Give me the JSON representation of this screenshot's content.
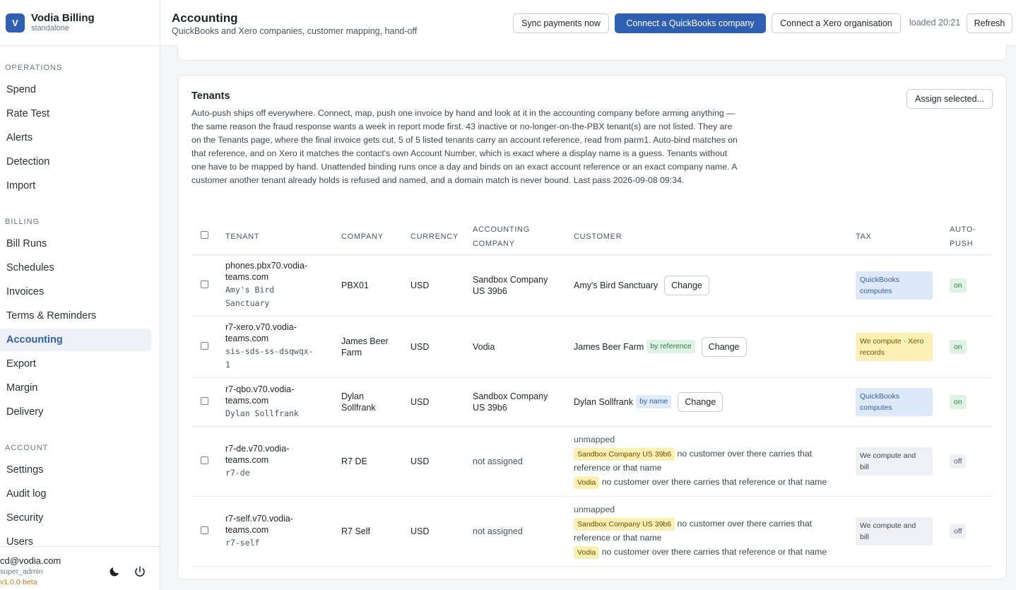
{
  "brand": {
    "logo_letter": "V",
    "name": "Vodia Billing",
    "sub": "standalone"
  },
  "nav": {
    "sections": [
      {
        "label": "OPERATIONS",
        "items": [
          "Spend",
          "Rate Test",
          "Alerts",
          "Detection",
          "Import"
        ]
      },
      {
        "label": "BILLING",
        "items": [
          "Bill Runs",
          "Schedules",
          "Invoices",
          "Terms & Reminders",
          "Accounting",
          "Export",
          "Margin",
          "Delivery"
        ]
      },
      {
        "label": "ACCOUNT",
        "items": [
          "Settings",
          "Audit log",
          "Security",
          "Users"
        ]
      }
    ],
    "active": "Accounting"
  },
  "user": {
    "email": "cd@vodia.com",
    "role": "super_admin",
    "version": "v1.0.0-beta"
  },
  "header": {
    "title": "Accounting",
    "subtitle": "QuickBooks and Xero companies, customer mapping, hand-off",
    "sync_label": "Sync payments now",
    "qb_label": "Connect a QuickBooks company",
    "xero_label": "Connect a Xero organisation",
    "loaded": "loaded 20:21",
    "refresh_label": "Refresh"
  },
  "tenants": {
    "title": "Tenants",
    "assign_label": "Assign selected...",
    "description": "Auto-push ships off everywhere. Connect, map, push one invoice by hand and look at it in the accounting company before arming anything — the same reason the fraud response wants a week in report mode first. 43 inactive or no-longer-on-the-PBX tenant(s) are not listed. They are on the Tenants page, where the final invoice gets cut. 5 of 5 listed tenants carry an account reference, read from parm1. Auto-bind matches on that reference, and on Xero it matches the contact's own Account Number, which is exact where a display name is a guess. Tenants without one have to be mapped by hand. Unattended binding runs once a day and binds on an exact account reference or an exact company name. A customer another tenant already holds is refused and named, and a domain match is never bound. Last pass 2026-09-08 09:34.",
    "columns": {
      "tenant": "TENANT",
      "company": "COMPANY",
      "currency": "CURRENCY",
      "accounting_1": "ACCOUNTING",
      "accounting_2": "COMPANY",
      "customer": "CUSTOMER",
      "tax": "TAX",
      "autopush_1": "AUTO-",
      "autopush_2": "PUSH"
    },
    "change_label": "Change",
    "rows": [
      {
        "host_1": "phones.pbx70.vodia-",
        "host_2": "teams.com",
        "ref_1": "Amy's Bird",
        "ref_2": "Sanctuary",
        "company": "PBX01",
        "currency": "USD",
        "acct_1": "Sandbox Company",
        "acct_2": "US 39b6",
        "customer": "Amy's Bird Sanctuary",
        "tax_1": "QuickBooks",
        "tax_2": "computes",
        "push": "on"
      },
      {
        "host_1": "r7-xero.v70.vodia-",
        "host_2": "teams.com",
        "ref_1": "sis-sds-ss-dsqwqx-",
        "ref_2": "1",
        "company_1": "James Beer",
        "company_2": "Farm",
        "currency": "USD",
        "acct": "Vodia",
        "customer": "James Beer Farm",
        "badge": "by reference",
        "tax_1": "We compute · Xero",
        "tax_2": "records",
        "push": "on"
      },
      {
        "host_1": "r7-qbo.v70.vodia-",
        "host_2": "teams.com",
        "ref": "Dylan Sollfrank",
        "company_1": "Dylan",
        "company_2": "Sollfrank",
        "currency": "USD",
        "acct_1": "Sandbox Company",
        "acct_2": "US 39b6",
        "customer": "Dylan Sollfrank",
        "badge": "by name",
        "tax_1": "QuickBooks",
        "tax_2": "computes",
        "push": "on"
      },
      {
        "host_1": "r7-de.v70.vodia-",
        "host_2": "teams.com",
        "ref": "r7-de",
        "company": "R7 DE",
        "currency": "USD",
        "acct": "not assigned",
        "unmapped": "unmapped",
        "qb_badge": "Sandbox Company US 39b6",
        "qb_msg_1": "no customer over there carries that",
        "qb_msg_2": "reference or that name",
        "xero_badge": "Vodia",
        "xero_msg": "no customer over there carries that reference or that name",
        "tax_1": "We compute and",
        "tax_2": "bill",
        "push": "off"
      },
      {
        "host_1": "r7-self.v70.vodia-",
        "host_2": "teams.com",
        "ref": "r7-self",
        "company": "R7 Self",
        "currency": "USD",
        "acct": "not assigned",
        "unmapped": "unmapped",
        "qb_badge": "Sandbox Company US 39b6",
        "qb_msg_1": "no customer over there carries that",
        "qb_msg_2": "reference or that name",
        "xero_badge": "Vodia",
        "xero_msg": "no customer over there carries that reference or that name",
        "tax_1": "We compute and",
        "tax_2": "bill",
        "push": "off"
      }
    ]
  },
  "icons": {
    "theme": "moon-icon",
    "power": "power-icon"
  },
  "colors": {
    "accent": "#2f5fb3",
    "on": "#2f7d4a",
    "warning": "#c07a13"
  }
}
